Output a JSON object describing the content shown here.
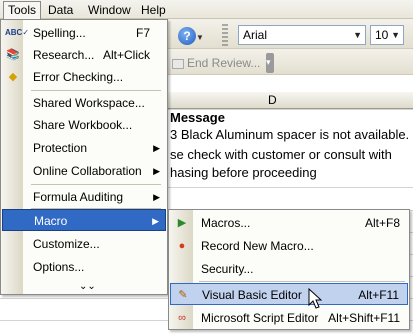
{
  "menubar": {
    "items": [
      {
        "label": "Tools"
      },
      {
        "label": "Data"
      },
      {
        "label": "Window"
      },
      {
        "label": "Help"
      }
    ]
  },
  "toolbar": {
    "font_name": "Arial",
    "font_size": "10",
    "end_review_label": "End Review..."
  },
  "sheet": {
    "column_label": "D",
    "title": "Message",
    "lines": [
      "3 Black Aluminum spacer is not available.",
      "se check with customer or consult with",
      "hasing before proceeding"
    ]
  },
  "tools_menu": {
    "items": [
      {
        "label": "Spelling...",
        "shortcut": "F7"
      },
      {
        "label": "Research...",
        "shortcut": "Alt+Click"
      },
      {
        "label": "Error Checking..."
      },
      {
        "label": "Shared Workspace..."
      },
      {
        "label": "Share Workbook..."
      },
      {
        "label": "Protection"
      },
      {
        "label": "Online Collaboration"
      },
      {
        "label": "Formula Auditing"
      },
      {
        "label": "Macro"
      },
      {
        "label": "Customize..."
      },
      {
        "label": "Options..."
      }
    ]
  },
  "macro_menu": {
    "items": [
      {
        "label": "Macros...",
        "shortcut": "Alt+F8"
      },
      {
        "label": "Record New Macro..."
      },
      {
        "label": "Security..."
      },
      {
        "label": "Visual Basic Editor",
        "shortcut": "Alt+F11"
      },
      {
        "label": "Microsoft Script Editor",
        "shortcut": "Alt+Shift+F11"
      }
    ]
  },
  "colors": {
    "selection": "#316ac5",
    "hover": "#c1d2ee",
    "menu_bg": "#fcfcf9"
  }
}
